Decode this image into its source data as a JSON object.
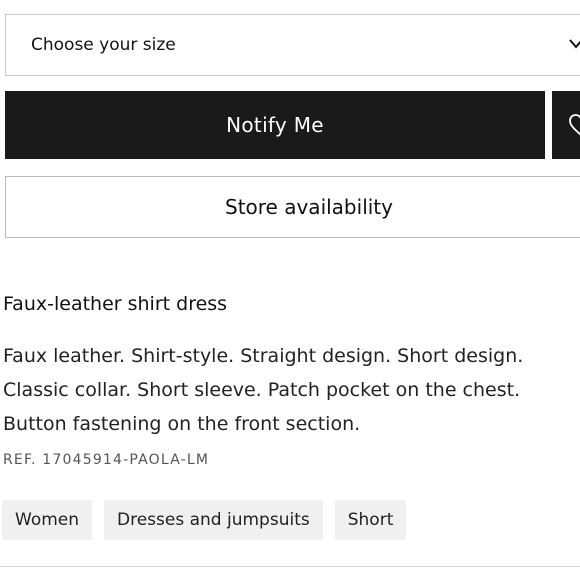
{
  "size_select": {
    "placeholder": "Choose your size",
    "icon": "chevron-down-icon"
  },
  "buttons": {
    "notify_label": "Notify Me",
    "wishlist_icon": "heart-icon",
    "store_label": "Store availability"
  },
  "product": {
    "title": "Faux-leather shirt dress",
    "description_lines": [
      "Faux leather. Shirt-style. Straight design. Short design.",
      "Classic collar. Short sleeve. Patch pocket on the chest.",
      "Button fastening on the front section."
    ],
    "reference": "REF. 17045914-PAOLA-LM"
  },
  "tags": [
    "Women",
    "Dresses and jumpsuits",
    "Short"
  ],
  "colors": {
    "primary_button": "#1a1a1c",
    "tag_background": "#f0f0f0"
  }
}
